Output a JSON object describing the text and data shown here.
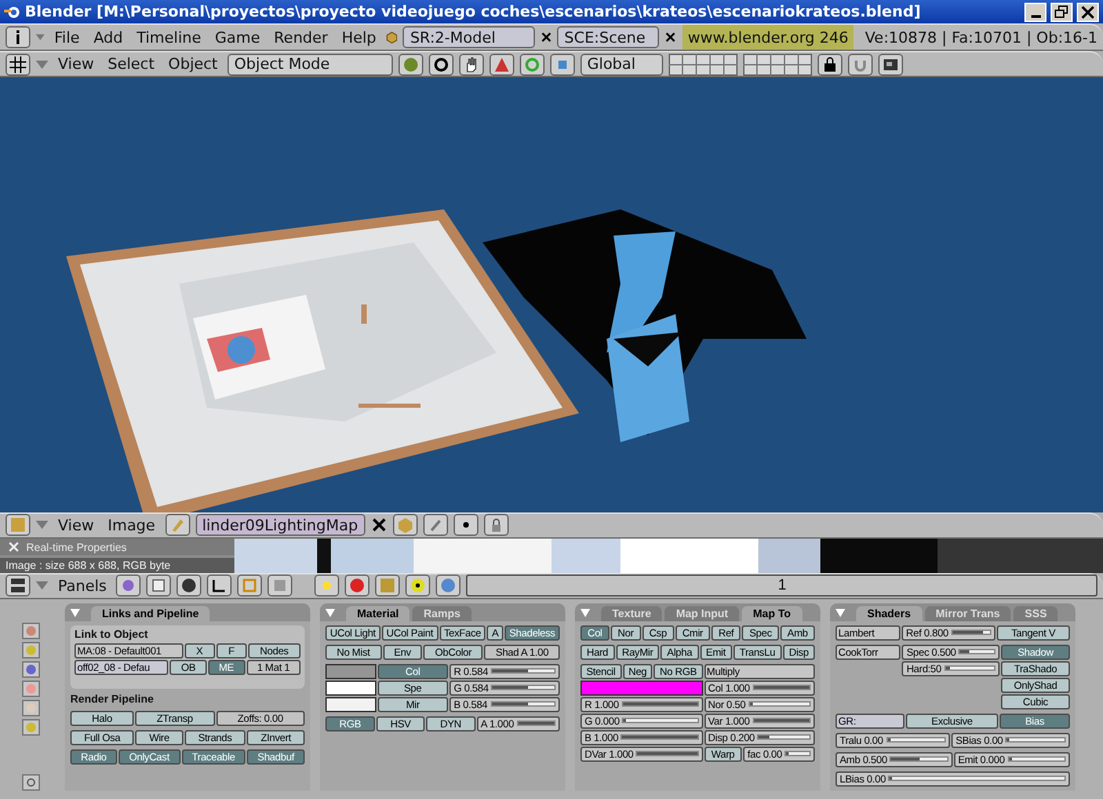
{
  "window": {
    "title": "Blender [M:\\Personal\\proyectos\\proyecto videojuego coches\\escenarios\\krateos\\escenariokrateos.blend]"
  },
  "info_header": {
    "menus": [
      "File",
      "Add",
      "Timeline",
      "Game",
      "Render",
      "Help"
    ],
    "screen": "SR:2-Model",
    "scene": "SCE:Scene",
    "site": "www.blender.org 246",
    "stats": "Ve:10878 | Fa:10701 | Ob:16-1"
  },
  "view3d_header": {
    "menus": [
      "View",
      "Select",
      "Object"
    ],
    "mode": "Object Mode",
    "orientation": "Global"
  },
  "image_header": {
    "menus": [
      "View",
      "Image"
    ],
    "image": "linder09LightingMap"
  },
  "image_overlay": {
    "panel": "Real-time Properties",
    "info": "Image : size 688 x 688, RGB byte"
  },
  "buttons_header": {
    "menu": "Panels",
    "frame": "1"
  },
  "panels": [
    {
      "tabs": [
        {
          "label": "Links and Pipeline",
          "selected": true
        }
      ],
      "body": [
        {
          "kind": "box",
          "items": [
            {
              "kind": "label",
              "label": "Link to Object"
            },
            {
              "kind": "row",
              "items": [
                {
                  "kind": "menu",
                  "label": "MA:08 - Default001"
                },
                {
                  "kind": "button",
                  "label": "X",
                  "on": false
                },
                {
                  "kind": "button",
                  "label": "F",
                  "on": false
                },
                {
                  "kind": "button",
                  "label": "Nodes",
                  "on": false
                }
              ]
            },
            {
              "kind": "row",
              "items": [
                {
                  "kind": "field",
                  "label": "off02_08 - Defau"
                },
                {
                  "kind": "button",
                  "label": "OB",
                  "on": false
                },
                {
                  "kind": "button",
                  "label": "ME",
                  "on": true
                },
                {
                  "kind": "number",
                  "label": "1 Mat 1"
                }
              ]
            }
          ]
        },
        {
          "kind": "label",
          "label": "Render Pipeline"
        },
        {
          "kind": "row",
          "items": [
            {
              "kind": "button",
              "label": "Halo",
              "on": false
            },
            {
              "kind": "button",
              "label": "ZTransp",
              "on": false
            },
            {
              "kind": "number",
              "label": "Zoffs: 0.00"
            }
          ]
        },
        {
          "kind": "row",
          "items": [
            {
              "kind": "button",
              "label": "Full Osa",
              "on": false
            },
            {
              "kind": "button",
              "label": "Wire",
              "on": false
            },
            {
              "kind": "button",
              "label": "Strands",
              "on": false
            },
            {
              "kind": "button",
              "label": "ZInvert",
              "on": false
            }
          ]
        },
        {
          "kind": "row",
          "items": [
            {
              "kind": "button",
              "label": "Radio",
              "on": true
            },
            {
              "kind": "button",
              "label": "OnlyCast",
              "on": true
            },
            {
              "kind": "button",
              "label": "Traceable",
              "on": true
            },
            {
              "kind": "button",
              "label": "Shadbuf",
              "on": true
            }
          ]
        }
      ]
    },
    {
      "tabs": [
        {
          "label": "Material",
          "selected": true
        },
        {
          "label": "Ramps",
          "selected": false
        }
      ],
      "body": [
        {
          "kind": "row",
          "items": [
            {
              "kind": "button",
              "label": "UCol Light",
              "on": false
            },
            {
              "kind": "button",
              "label": "UCol Paint",
              "on": false
            },
            {
              "kind": "button",
              "label": "TexFace",
              "on": false
            },
            {
              "kind": "button",
              "label": "A",
              "on": false
            },
            {
              "kind": "button",
              "label": "Shadeless",
              "on": true
            }
          ]
        },
        {
          "kind": "row",
          "items": [
            {
              "kind": "button",
              "label": "No Mist",
              "on": false
            },
            {
              "kind": "button",
              "label": "Env",
              "on": false
            },
            {
              "kind": "button",
              "label": "ObColor",
              "on": false
            },
            {
              "kind": "number",
              "label": "Shad A 1.00"
            }
          ]
        },
        {
          "kind": "row",
          "items": [
            {
              "kind": "column",
              "items": [
                {
                  "kind": "swatch",
                  "color": "#959595"
                },
                {
                  "kind": "swatch",
                  "color": "#ffffff"
                },
                {
                  "kind": "swatch",
                  "color": "#f2f2f2"
                }
              ]
            },
            {
              "kind": "column",
              "items": [
                {
                  "kind": "button",
                  "label": "Col",
                  "on": true
                },
                {
                  "kind": "button",
                  "label": "Spe",
                  "on": false
                },
                {
                  "kind": "button",
                  "label": "Mir",
                  "on": false
                }
              ]
            },
            {
              "kind": "column",
              "items": [
                {
                  "kind": "slider",
                  "label": "R 0.584",
                  "level": 0.584
                },
                {
                  "kind": "slider",
                  "label": "G 0.584",
                  "level": 0.584
                },
                {
                  "kind": "slider",
                  "label": "B 0.584",
                  "level": 0.584
                }
              ]
            }
          ]
        },
        {
          "kind": "row",
          "items": [
            {
              "kind": "button",
              "label": "RGB",
              "on": true
            },
            {
              "kind": "button",
              "label": "HSV",
              "on": false
            },
            {
              "kind": "button",
              "label": "DYN",
              "on": false
            },
            {
              "kind": "slider",
              "label": "A 1.000",
              "level": 1
            }
          ]
        }
      ]
    },
    {
      "tabs": [
        {
          "label": "Texture",
          "selected": false
        },
        {
          "label": "Map Input",
          "selected": false
        },
        {
          "label": "Map To",
          "selected": true
        }
      ],
      "body": [
        {
          "kind": "row",
          "items": [
            {
              "kind": "button",
              "label": "Col",
              "on": true
            },
            {
              "kind": "button",
              "label": "Nor",
              "on": false
            },
            {
              "kind": "button",
              "label": "Csp",
              "on": false
            },
            {
              "kind": "button",
              "label": "Cmir",
              "on": false
            },
            {
              "kind": "button",
              "label": "Ref",
              "on": false
            },
            {
              "kind": "button",
              "label": "Spec",
              "on": false
            },
            {
              "kind": "button",
              "label": "Amb",
              "on": false
            }
          ]
        },
        {
          "kind": "row",
          "items": [
            {
              "kind": "button",
              "label": "Hard",
              "on": false
            },
            {
              "kind": "button",
              "label": "RayMir",
              "on": false
            },
            {
              "kind": "button",
              "label": "Alpha",
              "on": false
            },
            {
              "kind": "button",
              "label": "Emit",
              "on": false
            },
            {
              "kind": "button",
              "label": "TransLu",
              "on": false
            },
            {
              "kind": "button",
              "label": "Disp",
              "on": false
            }
          ]
        },
        {
          "kind": "row",
          "items": [
            {
              "kind": "column",
              "items": [
                {
                  "kind": "row",
                  "items": [
                    {
                      "kind": "button",
                      "label": "Stencil",
                      "on": false
                    },
                    {
                      "kind": "button",
                      "label": "Neg",
                      "on": false
                    },
                    {
                      "kind": "button",
                      "label": "No RGB",
                      "on": false
                    }
                  ]
                },
                {
                  "kind": "swatch",
                  "color": "#ff00ff"
                },
                {
                  "kind": "slider",
                  "label": "R 1.000",
                  "level": 1
                },
                {
                  "kind": "slider",
                  "label": "G 0.000",
                  "level": 0
                },
                {
                  "kind": "slider",
                  "label": "B 1.000",
                  "level": 1
                },
                {
                  "kind": "slider",
                  "label": "DVar 1.000",
                  "level": 1
                }
              ]
            },
            {
              "kind": "column",
              "items": [
                {
                  "kind": "menu",
                  "label": "Multiply"
                },
                {
                  "kind": "slider",
                  "label": "Col 1.000",
                  "level": 1
                },
                {
                  "kind": "slider",
                  "label": "Nor 0.50",
                  "level": 0.02
                },
                {
                  "kind": "slider",
                  "label": "Var 1.000",
                  "level": 1
                },
                {
                  "kind": "slider",
                  "label": "Disp 0.200",
                  "level": 0.2
                },
                {
                  "kind": "row",
                  "items": [
                    {
                      "kind": "button",
                      "label": "Warp",
                      "on": false
                    },
                    {
                      "kind": "slider",
                      "label": "fac 0.00",
                      "level": 0
                    }
                  ]
                }
              ]
            }
          ]
        }
      ]
    },
    {
      "tabs": [
        {
          "label": "Shaders",
          "selected": true
        },
        {
          "label": "Mirror Trans",
          "selected": false
        },
        {
          "label": "SSS",
          "selected": false
        }
      ],
      "body": [
        {
          "kind": "row",
          "items": [
            {
              "kind": "menu",
              "label": "Lambert"
            },
            {
              "kind": "slider",
              "label": "Ref 0.800",
              "level": 0.8
            },
            {
              "kind": "button",
              "label": "Tangent V",
              "on": false
            }
          ]
        },
        {
          "kind": "row",
          "items": [
            {
              "kind": "menu",
              "label": "CookTorr"
            },
            {
              "kind": "column",
              "items": [
                {
                  "kind": "slider",
                  "label": "Spec 0.500",
                  "level": 0.25
                },
                {
                  "kind": "slider",
                  "label": "Hard:50",
                  "level": 0.1
                }
              ]
            },
            {
              "kind": "column",
              "items": [
                {
                  "kind": "button",
                  "label": "Shadow",
                  "on": true
                },
                {
                  "kind": "button",
                  "label": "TraShado",
                  "on": false
                },
                {
                  "kind": "button",
                  "label": "OnlyShad",
                  "on": false
                },
                {
                  "kind": "button",
                  "label": "Cubic",
                  "on": false
                }
              ]
            }
          ]
        },
        {
          "kind": "row",
          "items": [
            {
              "kind": "field",
              "label": "GR:"
            },
            {
              "kind": "button",
              "label": "Exclusive",
              "on": false
            },
            {
              "kind": "button",
              "label": "Bias",
              "on": true
            }
          ]
        },
        {
          "kind": "row",
          "items": [
            {
              "kind": "slider",
              "label": "Tralu 0.00",
              "level": 0
            },
            {
              "kind": "slider",
              "label": "SBias 0.00",
              "level": 0
            }
          ]
        },
        {
          "kind": "row",
          "items": [
            {
              "kind": "slider",
              "label": "Amb 0.500",
              "level": 0.5
            },
            {
              "kind": "slider",
              "label": "Emit 0.000",
              "level": 0
            }
          ]
        },
        {
          "kind": "row",
          "items": [
            {
              "kind": "slider",
              "label": "LBias 0.00",
              "level": 0
            }
          ]
        }
      ]
    }
  ]
}
